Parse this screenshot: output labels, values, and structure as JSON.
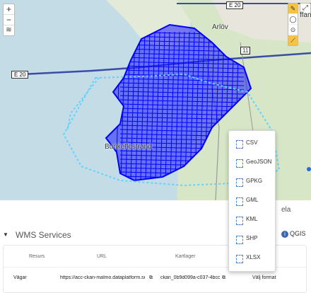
{
  "map": {
    "zoom_in": "+",
    "zoom_out": "−",
    "layers_icon": "≋",
    "road_badges": [
      "E 20",
      "E 20"
    ],
    "place_labels": [
      "Arlöv",
      "Bunkeflostrand",
      "ffan"
    ],
    "route_badge": "11"
  },
  "wms": {
    "title": "WMS Services",
    "qgis_label": "QGIS",
    "tab_label": "ela"
  },
  "table": {
    "headers": [
      "Resurs",
      "URL",
      "Kartlager"
    ],
    "row": {
      "resurs": "Vägar",
      "url": "https://acc-ckan-malmo.dataplatform.se",
      "kartlager": "ckan_0b9d099a-c037-4bcc-",
      "action": "Välj format"
    }
  },
  "format_menu": {
    "items": [
      "CSV",
      "GeoJSON",
      "GPKG",
      "GML",
      "KML",
      "SHP",
      "XLSX"
    ]
  },
  "colors": {
    "road_network": "#0000ff",
    "accent": "#3a67b0",
    "selection": "#5fd3ff"
  }
}
